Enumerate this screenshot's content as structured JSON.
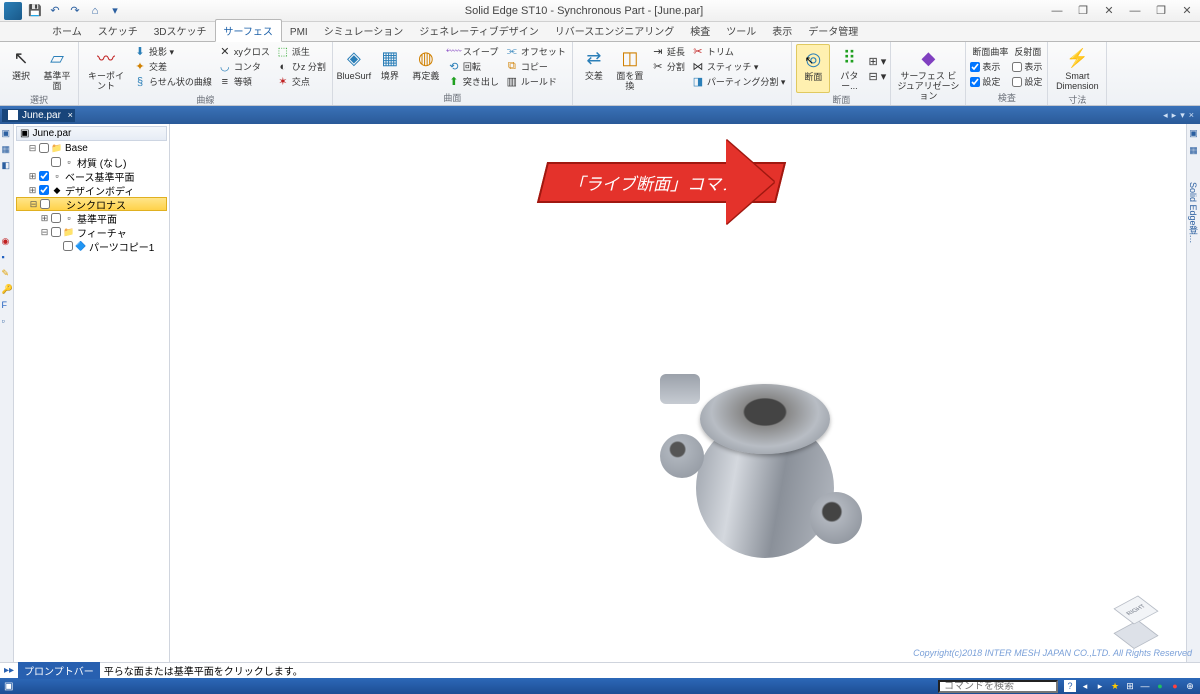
{
  "title": "Solid Edge ST10 - Synchronous Part - [June.par]",
  "qat": [
    "save",
    "undo",
    "redo",
    "home",
    "gear"
  ],
  "tabs": [
    "ホーム",
    "スケッチ",
    "3Dスケッチ",
    "サーフェス",
    "PMI",
    "シミュレーション",
    "ジェネレーティブデザイン",
    "リバースエンジニアリング",
    "検査",
    "ツール",
    "表示",
    "データ管理"
  ],
  "active_tab_index": 3,
  "ribbon": {
    "select": {
      "btn": "選択",
      "sub": "基準平面",
      "label": "選択"
    },
    "sketch": {
      "keypoint": "キーポイント",
      "project": "投影 ▾",
      "intersect": "交差",
      "cross": "xyクロス",
      "contour": "コンタ",
      "equal": "等頓",
      "derive": "派生",
      "wrap": "ひz 分割",
      "helix": "らせん状の曲線",
      "isect2": "交点",
      "label": "曲線"
    },
    "surface": {
      "bluesurf": "BlueSurf",
      "boundary": "境界",
      "redef": "再定義",
      "sweep": "スイープ",
      "rev": "回転",
      "extrude": "突き出し",
      "offset": "オフセット",
      "copy": "コピー",
      "ruled": "ルールド",
      "label": "曲面"
    },
    "edit": {
      "swap": "交差",
      "replace": "面を置換",
      "ext": "延長",
      "div": "分割",
      "trim": "トリム",
      "stitch": "スティッチ ▾",
      "parting": "パーティング分割 ▾",
      "label": ""
    },
    "section": {
      "a": "断面",
      "b": "パター...",
      "label": "断面"
    },
    "viz": {
      "btn": "サーフェス\nビジュアリゼーション",
      "label": ""
    },
    "inspect": {
      "curv": "断面曲率",
      "refl": "反射面",
      "disp": "表示",
      "disp2": "表示",
      "set": "設定",
      "set2": "設定",
      "label": "検査"
    },
    "dim": {
      "btn": "Smart\nDimension",
      "label": "寸法"
    }
  },
  "doctab": {
    "name": "June.par"
  },
  "tree": {
    "title": "June.par",
    "nodes": [
      {
        "indent": 1,
        "tw": "⊟",
        "chk": false,
        "icn": "📁",
        "txt": "Base"
      },
      {
        "indent": 2,
        "tw": "",
        "chk": false,
        "icn": "▫",
        "txt": "材質 (なし)"
      },
      {
        "indent": 1,
        "tw": "⊞",
        "chk": true,
        "icn": "▫",
        "txt": "ベース基準平面"
      },
      {
        "indent": 1,
        "tw": "⊞",
        "chk": true,
        "icn": "◆",
        "txt": "デザインボディ"
      },
      {
        "indent": 1,
        "tw": "⊟",
        "chk": false,
        "icn": "",
        "txt": "シンクロナス",
        "sel": true
      },
      {
        "indent": 2,
        "tw": "⊞",
        "chk": false,
        "icn": "▫",
        "txt": "基準平面"
      },
      {
        "indent": 2,
        "tw": "⊟",
        "chk": false,
        "icn": "📁",
        "txt": "フィーチャ"
      },
      {
        "indent": 3,
        "tw": "",
        "chk": false,
        "icn": "🔷",
        "txt": "パーツコピー1"
      }
    ]
  },
  "callout": "「ライブ断面」コマンド",
  "viewcube": "RIGHT",
  "prompt": {
    "label": "プロンプトバー",
    "text": "平らな面または基準平面をクリックします。"
  },
  "copyright": "Copyright(c)2018 INTER MESH JAPAN CO.,LTD. All Rights Reserved",
  "status": {
    "search": "コマンドを検索"
  }
}
